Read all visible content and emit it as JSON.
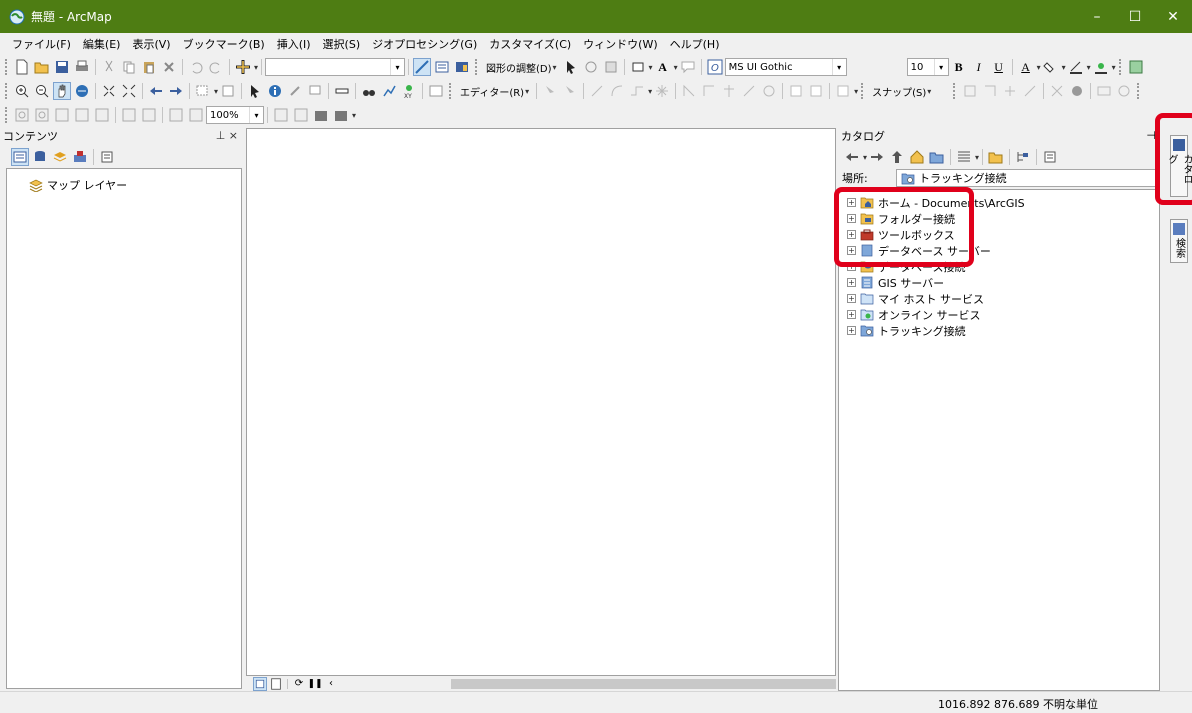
{
  "window": {
    "title": "無題 - ArcMap",
    "controls": [
      "–",
      "☐",
      "✕"
    ]
  },
  "menu": [
    "ファイル(F)",
    "編集(E)",
    "表示(V)",
    "ブックマーク(B)",
    "挿入(I)",
    "選択(S)",
    "ジオプロセシング(G)",
    "カスタマイズ(C)",
    "ウィンドウ(W)",
    "ヘルプ(H)"
  ],
  "toolbar": {
    "drawing_label": "図形の調整(D)",
    "font_name": "MS UI Gothic",
    "font_size": "10",
    "bold": "B",
    "italic": "I",
    "underline": "U",
    "font_color": "A",
    "editor_label": "エディター(R)",
    "snap_label": "スナップ(S)",
    "zoom_level": "100%"
  },
  "toc": {
    "title": "コンテンツ",
    "pin": "⊥",
    "close": "×",
    "layer": "マップ レイヤー"
  },
  "catalog": {
    "title": "カタログ",
    "location_label": "場所:",
    "location_value": "トラッキング接続",
    "items": [
      {
        "label": "ホーム - Documents\\ArcGIS",
        "icon": "home-folder-icon"
      },
      {
        "label": "フォルダー接続",
        "icon": "folder-connection-icon"
      },
      {
        "label": "ツールボックス",
        "icon": "toolbox-icon"
      },
      {
        "label": "データベース サーバー",
        "icon": "database-server-icon"
      },
      {
        "label": "データベース接続",
        "icon": "database-connection-icon"
      },
      {
        "label": "GIS サーバー",
        "icon": "gis-server-icon"
      },
      {
        "label": "マイ ホスト サービス",
        "icon": "hosted-services-icon"
      },
      {
        "label": "オンライン サービス",
        "icon": "online-services-icon"
      },
      {
        "label": "トラッキング接続",
        "icon": "tracking-connection-icon"
      }
    ]
  },
  "side_tabs": [
    "カタログ",
    "検索"
  ],
  "status": {
    "coordinates": "1016.892  876.689 不明な単位"
  },
  "colors": {
    "titlebar": "#4e7d13",
    "highlight": "#e0001b",
    "folder": "#f2c14e"
  }
}
